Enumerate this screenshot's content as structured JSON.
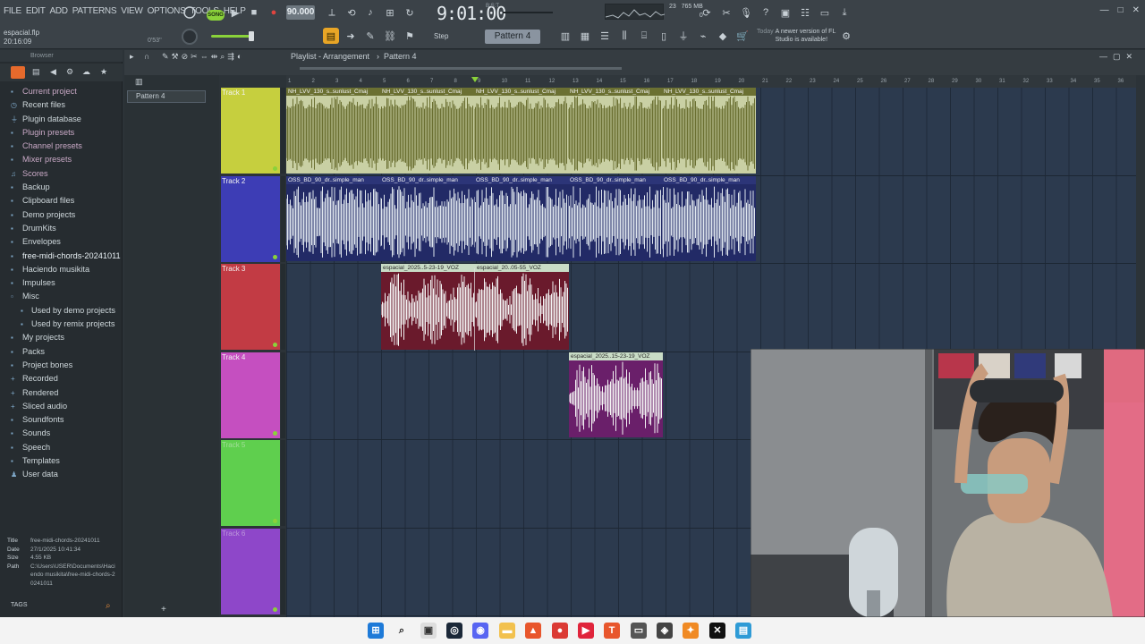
{
  "menu": [
    "FILE",
    "EDIT",
    "ADD",
    "PATTERNS",
    "VIEW",
    "OPTIONS",
    "TOOLS",
    "HELP"
  ],
  "project": {
    "file": "espacial.flp",
    "time": "20:16:09",
    "cpu_time": "0'53''"
  },
  "transport": {
    "song_label": "SONG",
    "tempo": "90.000",
    "clock": "9:01:00",
    "clock_sub": "B:S:T"
  },
  "monitor": {
    "cpu": "23",
    "ram": "765 MB",
    "voices": "0"
  },
  "snap": "Step",
  "pattern_selector": "Pattern 4",
  "news": {
    "date": "Today",
    "message": "A newer version of FL Studio is available!"
  },
  "browser": {
    "title": "Browser",
    "items": [
      {
        "label": "Current project",
        "icon": "folder-icon",
        "kind": "pink"
      },
      {
        "label": "Recent files",
        "icon": "clock-icon",
        "kind": "normal"
      },
      {
        "label": "Plugin database",
        "icon": "plug-icon",
        "kind": "normal"
      },
      {
        "label": "Plugin presets",
        "icon": "preset-icon",
        "kind": "pink"
      },
      {
        "label": "Channel presets",
        "icon": "preset-icon",
        "kind": "pink"
      },
      {
        "label": "Mixer presets",
        "icon": "preset-icon",
        "kind": "pink"
      },
      {
        "label": "Scores",
        "icon": "score-icon",
        "kind": "pink"
      },
      {
        "label": "Backup",
        "icon": "folder-icon",
        "kind": "normal"
      },
      {
        "label": "Clipboard files",
        "icon": "folder-icon",
        "kind": "normal"
      },
      {
        "label": "Demo projects",
        "icon": "folder-icon",
        "kind": "normal"
      },
      {
        "label": "DrumKits",
        "icon": "folder-icon",
        "kind": "normal"
      },
      {
        "label": "Envelopes",
        "icon": "folder-icon",
        "kind": "normal"
      },
      {
        "label": "free-midi-chords-20241011",
        "icon": "folder-icon",
        "kind": "bold"
      },
      {
        "label": "Haciendo musikita",
        "icon": "folder-icon",
        "kind": "normal"
      },
      {
        "label": "Impulses",
        "icon": "folder-icon",
        "kind": "normal"
      },
      {
        "label": "Misc",
        "icon": "folder-open-icon",
        "kind": "normal"
      },
      {
        "label": "Used by demo projects",
        "icon": "folder-icon",
        "kind": "sub"
      },
      {
        "label": "Used by remix projects",
        "icon": "folder-icon",
        "kind": "sub"
      },
      {
        "label": "My projects",
        "icon": "folder-icon",
        "kind": "normal"
      },
      {
        "label": "Packs",
        "icon": "folder-icon",
        "kind": "normal"
      },
      {
        "label": "Project bones",
        "icon": "folder-icon",
        "kind": "normal"
      },
      {
        "label": "Recorded",
        "icon": "plus-icon",
        "kind": "normal"
      },
      {
        "label": "Rendered",
        "icon": "plus-icon",
        "kind": "normal"
      },
      {
        "label": "Sliced audio",
        "icon": "plus-icon",
        "kind": "normal"
      },
      {
        "label": "Soundfonts",
        "icon": "folder-icon",
        "kind": "normal"
      },
      {
        "label": "Sounds",
        "icon": "folder-icon",
        "kind": "normal"
      },
      {
        "label": "Speech",
        "icon": "folder-icon",
        "kind": "normal"
      },
      {
        "label": "Templates",
        "icon": "folder-icon",
        "kind": "normal"
      },
      {
        "label": "User data",
        "icon": "user-icon",
        "kind": "normal"
      }
    ],
    "info": {
      "title_k": "Title",
      "title_v": "free-midi-chords-20241011",
      "date_k": "Date",
      "date_v": "27/1/2025 10:41:34",
      "size_k": "Size",
      "size_v": "4.55 KB",
      "path_k": "Path",
      "path_v": "C:\\Users\\USER\\Documents\\Haciendo musikita\\free-midi-chords-20241011"
    },
    "tags_label": "TAGS"
  },
  "playlist": {
    "title": "Playlist - Arrangement",
    "pattern": "Pattern 4",
    "pattern_list": [
      "Pattern 4"
    ],
    "ruler": [
      "1",
      "2",
      "3",
      "4",
      "5",
      "6",
      "7",
      "8",
      "9",
      "10",
      "11",
      "12",
      "13",
      "14",
      "15",
      "16",
      "17",
      "18",
      "19",
      "20",
      "21",
      "22",
      "23",
      "24",
      "25",
      "26",
      "27",
      "28",
      "29",
      "30",
      "31",
      "32",
      "33",
      "34",
      "35",
      "36"
    ],
    "tracks": [
      {
        "name": "Track 1",
        "color": "#c6cf3e"
      },
      {
        "name": "Track 2",
        "color": "#3d3db5"
      },
      {
        "name": "Track 3",
        "color": "#c23b44"
      },
      {
        "name": "Track 4",
        "color": "#c54fc0"
      },
      {
        "name": "Track 5",
        "color": "#5fcf4e"
      },
      {
        "name": "Track 6",
        "color": "#8e47c9"
      }
    ],
    "clips": {
      "t1": [
        "NH_LVV_130_s..sunlust_Cmaj",
        "NH_LVV_130_s..sunlust_Cmaj",
        "NH_LVV_130_s..sunlust_Cmaj",
        "NH_LVV_130_s..sunlust_Cmaj",
        "NH_LVV_130_s..sunlust_Cmaj"
      ],
      "t2": [
        "OSS_BD_90_dr..simple_man",
        "OSS_BD_90_dr..simple_man",
        "OSS_BD_90_dr..simple_man",
        "OSS_BD_90_dr..simple_man",
        "OSS_BD_90_dr..simple_man"
      ],
      "t3": [
        "espacial_2025..5-23-19_VOZ",
        "espacial_20..05-55_VOZ"
      ],
      "t4": [
        "espacial_2025..15-23-19_VOZ"
      ]
    }
  },
  "colors": {
    "accent": "#8ad23a",
    "clip_t1": "#6b7032",
    "clip_t2": "#222a66",
    "clip_t3": "#6a1a2c",
    "clip_t4": "#6a1f6a"
  }
}
